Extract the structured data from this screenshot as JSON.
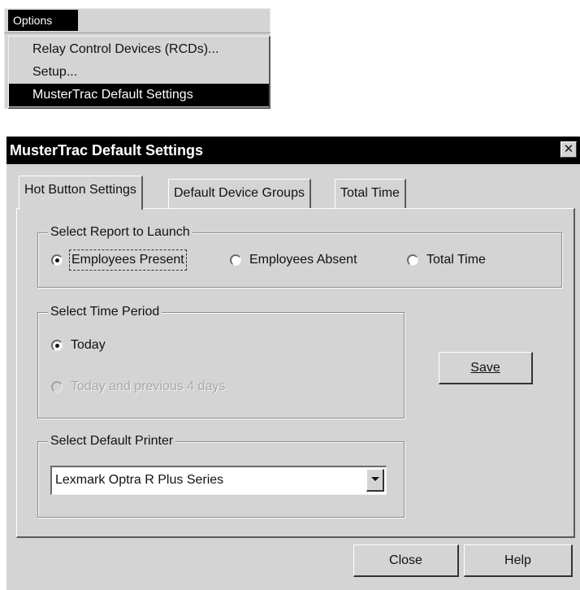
{
  "menu": {
    "title": "Options",
    "items": [
      {
        "label": "Relay Control Devices (RCDs)..."
      },
      {
        "label": "Setup..."
      },
      {
        "label": "MusterTrac Default Settings"
      }
    ]
  },
  "dialog": {
    "title": "MusterTrac Default Settings",
    "close_glyph": "✕",
    "tabs": [
      {
        "label": "Hot Button Settings",
        "active": true
      },
      {
        "label": "Default Device Groups",
        "active": false
      },
      {
        "label": "Total Time",
        "active": false
      }
    ],
    "report_group": {
      "label": "Select Report to Launch",
      "options": [
        {
          "label": "Employees Present",
          "checked": true
        },
        {
          "label": "Employees Absent",
          "checked": false
        },
        {
          "label": "Total Time",
          "checked": false
        }
      ]
    },
    "time_group": {
      "label": "Select Time Period",
      "options": [
        {
          "label": "Today",
          "checked": true,
          "enabled": true
        },
        {
          "label": "Today and previous 4 days",
          "checked": false,
          "enabled": false
        }
      ]
    },
    "printer_group": {
      "label": "Select Default Printer",
      "selected": "Lexmark Optra R Plus Series"
    },
    "buttons": {
      "save": "Save",
      "close": "Close",
      "help": "Help"
    }
  }
}
